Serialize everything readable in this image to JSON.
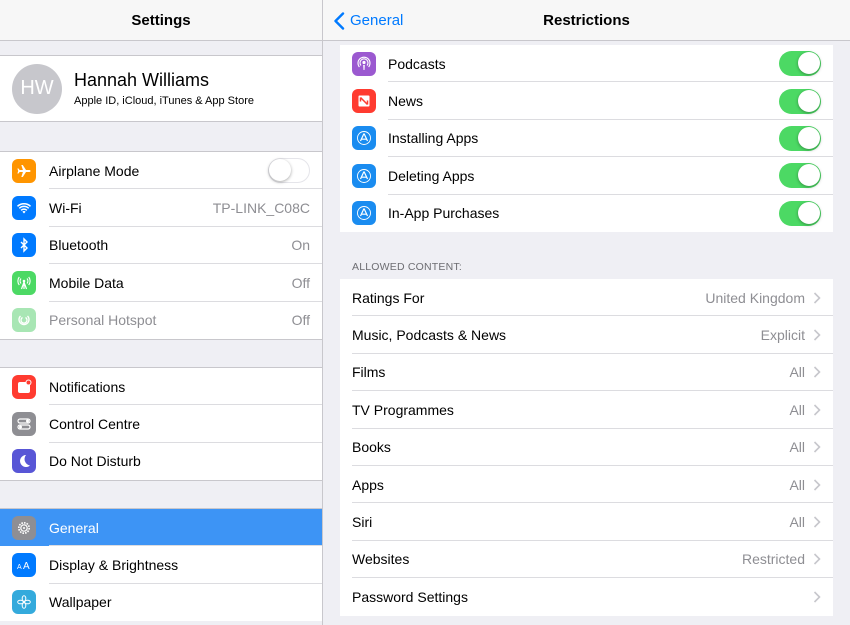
{
  "sidebar": {
    "title": "Settings",
    "profile": {
      "initials": "HW",
      "name": "Hannah Williams",
      "subtitle": "Apple ID, iCloud, iTunes & App Store"
    },
    "group1": [
      {
        "label": "Airplane Mode",
        "icon": "airplane-icon",
        "color": "#ff9500",
        "toggle": "off"
      },
      {
        "label": "Wi-Fi",
        "icon": "wifi-icon",
        "color": "#007aff",
        "value": "TP-LINK_C08C"
      },
      {
        "label": "Bluetooth",
        "icon": "bluetooth-icon",
        "color": "#007aff",
        "value": "On"
      },
      {
        "label": "Mobile Data",
        "icon": "antenna-icon",
        "color": "#4cd964",
        "value": "Off"
      },
      {
        "label": "Personal Hotspot",
        "icon": "hotspot-icon",
        "color": "#a8e6b4",
        "value": "Off",
        "dim": true
      }
    ],
    "group2": [
      {
        "label": "Notifications",
        "icon": "notifications-icon",
        "color": "#ff3b30"
      },
      {
        "label": "Control Centre",
        "icon": "control-centre-icon",
        "color": "#8e8e93"
      },
      {
        "label": "Do Not Disturb",
        "icon": "moon-icon",
        "color": "#5856d6"
      }
    ],
    "group3": [
      {
        "label": "General",
        "icon": "gear-icon",
        "color": "#8e8e93",
        "selected": true
      },
      {
        "label": "Display & Brightness",
        "icon": "display-icon",
        "color": "#007aff"
      },
      {
        "label": "Wallpaper",
        "icon": "wallpaper-icon",
        "color": "#34aadc"
      }
    ]
  },
  "detail": {
    "back_label": "General",
    "title": "Restrictions",
    "toggles": [
      {
        "label": "Podcasts",
        "icon": "podcasts-icon",
        "color": "#9b59d0",
        "state": "on"
      },
      {
        "label": "News",
        "icon": "news-icon",
        "color": "#ff3b30",
        "state": "on"
      },
      {
        "label": "Installing Apps",
        "icon": "app-store-icon",
        "color": "#1a8cf0",
        "state": "on"
      },
      {
        "label": "Deleting Apps",
        "icon": "app-store-icon",
        "color": "#1a8cf0",
        "state": "on"
      },
      {
        "label": "In-App Purchases",
        "icon": "app-store-icon",
        "color": "#1a8cf0",
        "state": "on"
      }
    ],
    "allowed_content_header": "ALLOWED CONTENT:",
    "allowed_content": [
      {
        "label": "Ratings For",
        "value": "United Kingdom"
      },
      {
        "label": "Music, Podcasts & News",
        "value": "Explicit"
      },
      {
        "label": "Films",
        "value": "All"
      },
      {
        "label": "TV Programmes",
        "value": "All"
      },
      {
        "label": "Books",
        "value": "All"
      },
      {
        "label": "Apps",
        "value": "All"
      },
      {
        "label": "Siri",
        "value": "All"
      },
      {
        "label": "Websites",
        "value": "Restricted"
      },
      {
        "label": "Password Settings",
        "value": ""
      }
    ]
  }
}
